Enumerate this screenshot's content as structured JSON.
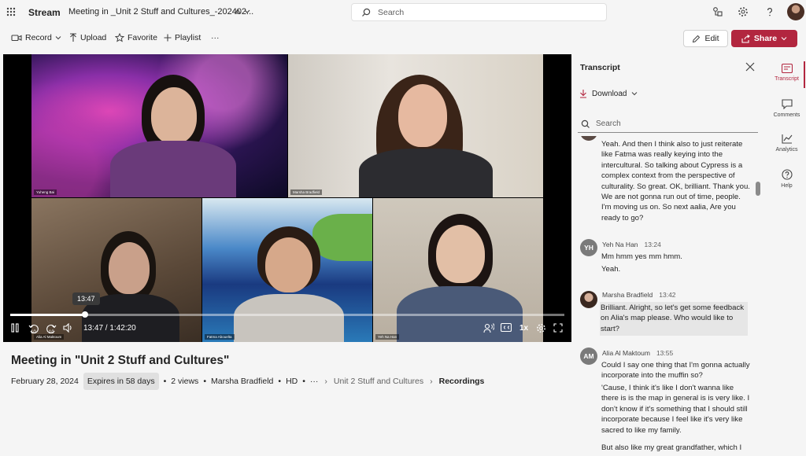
{
  "app": {
    "name": "Stream",
    "title": "Meeting in _Unit 2 Stuff and Cultures_-202402...",
    "search_placeholder": "Search"
  },
  "commands": {
    "record": "Record",
    "upload": "Upload",
    "favorite": "Favorite",
    "playlist": "Playlist",
    "more": "···",
    "edit": "Edit",
    "share": "Share"
  },
  "video": {
    "tooltip_time": "13:47",
    "timecode": "13:47 / 1:42:20",
    "progress_fraction": 0.1345,
    "speed": "1x",
    "skip_back": "10",
    "skip_forward": "10",
    "participants": [
      "Yuheng Bai",
      "Marsha Bradfield",
      "Alia Al Maktoum",
      "Fatma Abouelta",
      "Yeh Na Han"
    ]
  },
  "details": {
    "title": "Meeting in \"Unit 2 Stuff and Cultures\"",
    "date": "February 28, 2024",
    "expires": "Expires in 58 days",
    "views": "2 views",
    "owner": "Marsha Bradfield",
    "quality": "HD",
    "more": "···",
    "breadcrumb": [
      "Unit 2 Stuff and Cultures",
      "Recordings"
    ]
  },
  "transcript": {
    "title": "Transcript",
    "download": "Download",
    "search_placeholder": "Search",
    "entries": [
      {
        "initials": "",
        "color": "#5a4a44",
        "speaker": "",
        "time": "",
        "lines": [
          "Yeah. And then I think also to just reiterate like Fatma was really keying into the intercultural. So talking about Cypress is a complex context from the perspective of culturality. So great. OK, brilliant. Thank you. We are not gonna run out of time, people. I'm moving us on. So next aalia, Are you ready to go?"
        ]
      },
      {
        "initials": "YH",
        "color": "#7a7a7a",
        "speaker": "Yeh Na Han",
        "time": "13:24",
        "lines": [
          "Mm hmm yes mm hmm.",
          "Yeah."
        ]
      },
      {
        "initials": "",
        "color": "#5a4a44",
        "speaker": "Marsha Bradfield",
        "time": "13:42",
        "lines": [
          "Brilliant. Alright, so let's get some feedback on Alia's map please. Who would like to start?"
        ]
      },
      {
        "initials": "AM",
        "color": "#7a7a7a",
        "speaker": "Alia Al Maktoum",
        "time": "13:55",
        "lines": [
          "Could I say one thing that I'm gonna actually incorporate into the muffin so?",
          "'Cause, I think it's like I don't wanna like there is is the map in general is is very like. I don't know if it's something that I should still incorporate because I feel like it's very like sacred to like my family.",
          "But also like my great grandfather, which I"
        ]
      }
    ]
  },
  "rail": {
    "transcript": "Transcript",
    "comments": "Comments",
    "analytics": "Analytics",
    "help": "Help"
  },
  "colors": {
    "accent": "#b2263f"
  }
}
